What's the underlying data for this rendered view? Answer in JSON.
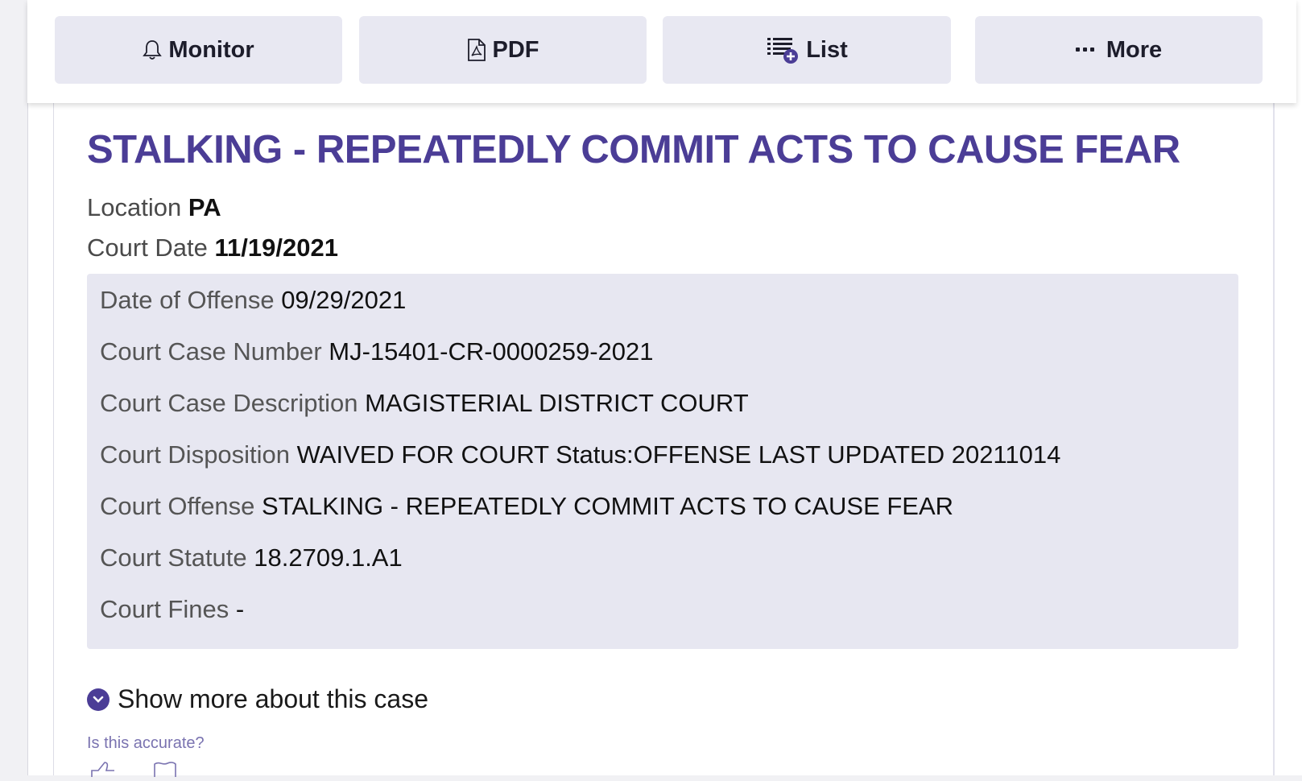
{
  "toolbar": {
    "monitor_label": "Monitor",
    "pdf_label": "PDF",
    "list_label": "List",
    "more_label": "More",
    "icons": [
      "bell-icon",
      "pdf-file-icon",
      "list-add-icon",
      "ellipsis-icon"
    ]
  },
  "record": {
    "title": "STALKING - REPEATEDLY COMMIT ACTS TO CAUSE FEAR",
    "location_label": "Location",
    "location_value": "PA",
    "court_date_label": "Court Date",
    "court_date_value": "11/19/2021"
  },
  "details": [
    {
      "label": "Date of Offense",
      "value": "09/29/2021"
    },
    {
      "label": "Court Case Number",
      "value": "MJ-15401-CR-0000259-2021"
    },
    {
      "label": "Court Case Description",
      "value": "MAGISTERIAL DISTRICT COURT"
    },
    {
      "label": "Court Disposition",
      "value": "WAIVED FOR COURT Status:OFFENSE LAST UPDATED 20211014"
    },
    {
      "label": "Court Offense",
      "value": "STALKING - REPEATEDLY COMMIT ACTS TO CAUSE FEAR"
    },
    {
      "label": "Court Statute",
      "value": "18.2709.1.A1"
    },
    {
      "label": "Court Fines",
      "value": "-"
    }
  ],
  "show_more_label": "Show more about this case",
  "feedback": {
    "question": "Is this accurate?",
    "icons": [
      "thumbs-up-icon",
      "flag-icon"
    ]
  },
  "colors": {
    "accent": "#4b3d96",
    "button_bg": "#e8e8f2",
    "details_bg": "#e7e7f1"
  }
}
